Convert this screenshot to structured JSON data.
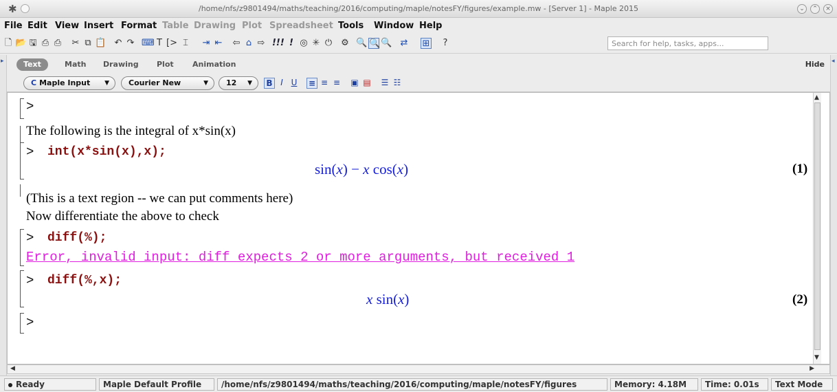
{
  "window": {
    "title": "/home/nfs/z9801494/maths/teaching/2016/computing/maple/notesFY/figures/example.mw - [Server 1] - Maple 2015"
  },
  "menu": {
    "file": "File",
    "edit": "Edit",
    "view": "View",
    "insert": "Insert",
    "format": "Format",
    "table": "Table",
    "drawing": "Drawing",
    "plot": "Plot",
    "spreadsheet": "Spreadsheet",
    "tools": "Tools",
    "window": "Window",
    "help": "Help"
  },
  "toolbar": {
    "search_placeholder": "Search for help, tasks, apps..."
  },
  "context_tabs": {
    "text": "Text",
    "math": "Math",
    "drawing": "Drawing",
    "plot": "Plot",
    "animation": "Animation",
    "hide": "Hide"
  },
  "format_bar": {
    "input_mode": "Maple Input",
    "input_mode_icon": "C",
    "font": "Courier New",
    "size": "12"
  },
  "worksheet": {
    "prompt": ">",
    "text1": "The following is the integral of x*sin(x)",
    "cmd1": "int(x*sin(x),x);",
    "out1_label": "(1)",
    "text2": "(This is a text region -- we can put comments here)",
    "text3": "Now differentiate the above to check",
    "cmd2": "diff(%);",
    "error": "Error, invalid input: diff expects 2 or more arguments, but received 1",
    "cmd3": "diff(%,x);",
    "out2_label": "(2)"
  },
  "status": {
    "ready": "Ready",
    "profile": "Maple Default Profile",
    "path": "/home/nfs/z9801494/maths/teaching/2016/computing/maple/notesFY/figures",
    "memory": "Memory: 4.18M",
    "time": "Time: 0.01s",
    "mode": "Text Mode"
  }
}
